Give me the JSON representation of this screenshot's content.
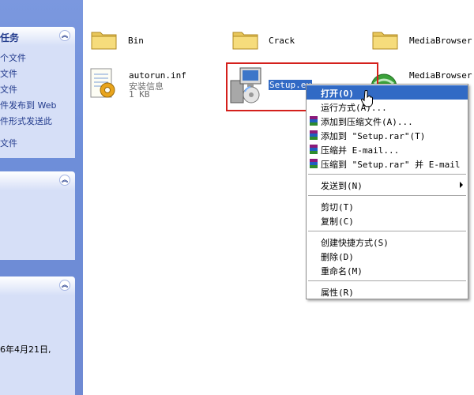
{
  "task_pane": {
    "panel1": {
      "title": "任务",
      "links": [
        "个文件",
        "文件",
        "文件",
        "件发布到 Web",
        "件形式发送此",
        "文件"
      ]
    },
    "panel3_text": "6年4月21日,"
  },
  "files": {
    "bin": {
      "name": "Bin"
    },
    "crack": {
      "name": "Crack"
    },
    "mediabrowser_folder": {
      "name": "MediaBrowser"
    },
    "autorun": {
      "name": "autorun.inf",
      "type": "安装信息",
      "size": "1 KB"
    },
    "setup": {
      "name": "Setup.ex"
    },
    "mediabrowser_exe": {
      "name": "MediaBrowser."
    }
  },
  "context_menu": {
    "open": "打开(O)",
    "run_as": "运行方式(A)...",
    "add_to_archive": "添加到压缩文件(A)...",
    "add_to_setup_rar": "添加到 \"Setup.rar\"(T)",
    "compress_email": "压缩并 E-mail...",
    "compress_setup_rar_email": "压缩到 \"Setup.rar\" 并 E-mail",
    "send_to": "发送到(N)",
    "cut": "剪切(T)",
    "copy": "复制(C)",
    "create_shortcut": "创建快捷方式(S)",
    "delete": "删除(D)",
    "rename": "重命名(M)",
    "properties": "属性(R)"
  },
  "colors": {
    "menu_highlight": "#316ac5",
    "selection_box": "#d4201c",
    "task_pane_bg": "#6f8ad3"
  }
}
